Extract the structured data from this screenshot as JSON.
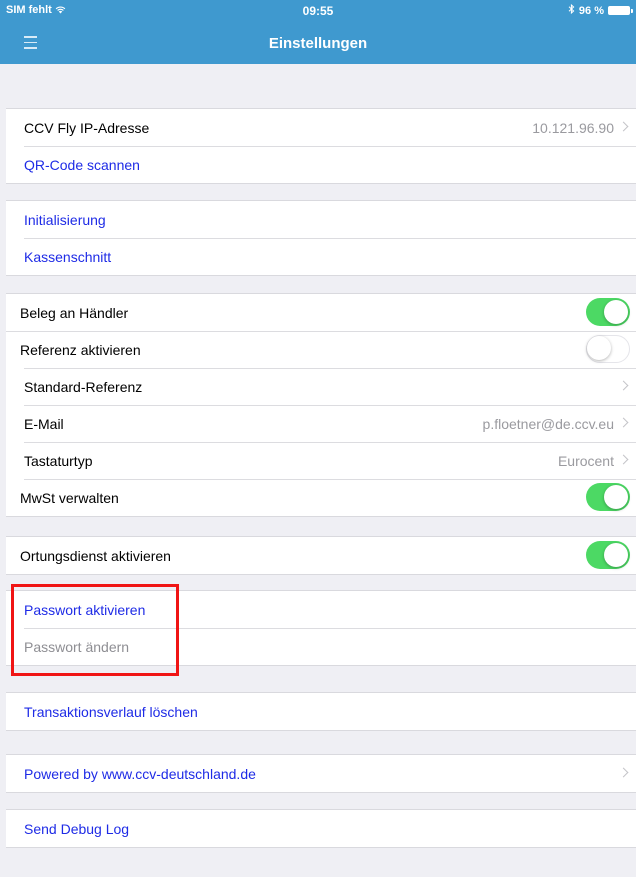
{
  "status_bar": {
    "carrier": "SIM fehlt",
    "wifi_icon": "wifi-icon",
    "time": "09:55",
    "bluetooth_icon": "bluetooth-icon",
    "battery": "96 %"
  },
  "nav": {
    "title": "Einstellungen",
    "menu_icon": "hamburger-menu-icon"
  },
  "colors": {
    "nav_bar": "#3f99cf",
    "link_blue": "#1e2be6",
    "toggle_on": "#4cd964",
    "background": "#efeff4",
    "highlight": "#f01414"
  },
  "sections": {
    "connection": {
      "ip_label": "CCV Fly IP-Adresse",
      "ip_value": "10.121.96.90",
      "qr_label": "QR-Code scannen"
    },
    "actions": {
      "init_label": "Initialisierung",
      "kassenschnitt_label": "Kassenschnitt"
    },
    "receipt": {
      "beleg_label": "Beleg an Händler",
      "beleg_on": true,
      "referenz_label": "Referenz aktivieren",
      "referenz_on": false,
      "standard_ref_label": "Standard-Referenz",
      "email_label": "E-Mail",
      "email_value": "p.floetner@de.ccv.eu",
      "keyboard_label": "Tastaturtyp",
      "keyboard_value": "Eurocent",
      "mwst_label": "MwSt verwalten",
      "mwst_on": true
    },
    "location": {
      "label": "Ortungsdienst aktivieren",
      "on": true
    },
    "password": {
      "activate_label": "Passwort aktivieren",
      "change_label": "Passwort ändern"
    },
    "history": {
      "clear_label": "Transaktionsverlauf löschen"
    },
    "about": {
      "powered_label": "Powered by www.ccv-deutschland.de"
    },
    "debug": {
      "send_label": "Send Debug Log"
    }
  }
}
